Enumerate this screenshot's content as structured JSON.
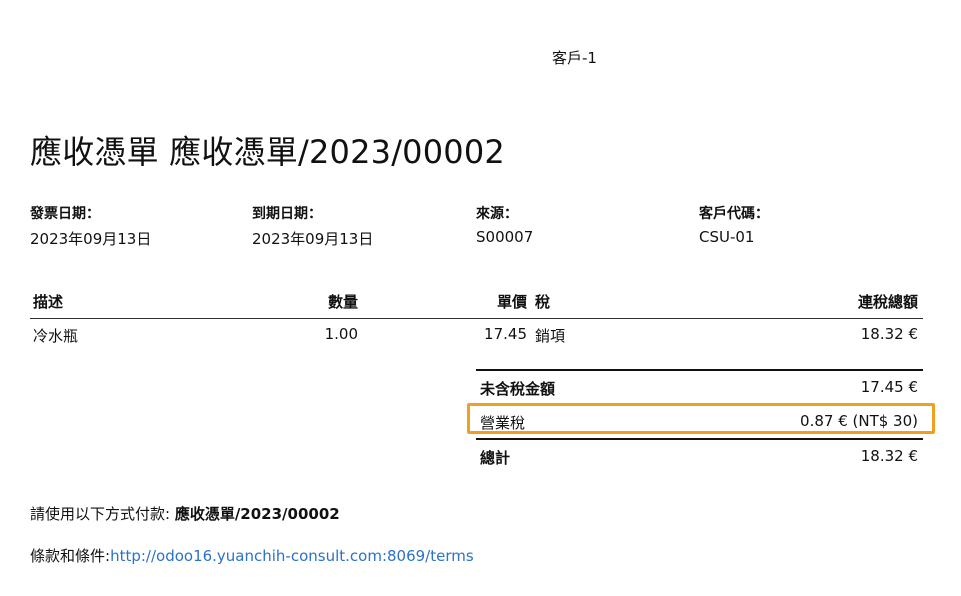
{
  "header": {
    "customer_name": "客戶-1",
    "title": "應收憑單 應收憑單/2023/00002"
  },
  "info": [
    {
      "label": "發票日期：",
      "value": "2023年09月13日"
    },
    {
      "label": "到期日期：",
      "value": "2023年09月13日"
    },
    {
      "label": "來源：",
      "value": "S00007"
    },
    {
      "label": "客戶代碼：",
      "value": "CSU-01"
    }
  ],
  "table": {
    "headers": {
      "description": "描述",
      "quantity": "數量",
      "unit_price": "單價",
      "tax": "稅",
      "total": "連稅總額"
    },
    "rows": [
      {
        "description": "冷水瓶",
        "quantity": "1.00",
        "unit_price": "17.45",
        "tax": "銷項",
        "total": "18.32 €"
      }
    ]
  },
  "totals": {
    "untaxed_label": "未含稅金額",
    "untaxed_value": "17.45 €",
    "tax_label": "營業稅",
    "tax_value": "0.87 € (NT$ 30)",
    "total_label": "總計",
    "total_value": "18.32 €"
  },
  "footer": {
    "payment_prefix": "請使用以下方式付款: ",
    "payment_reference": "應收憑單/2023/00002",
    "terms_prefix": "條款和條件:",
    "terms_link": "http://odoo16.yuanchih-consult.com:8069/terms"
  },
  "colors": {
    "highlight": "#f0a020",
    "link": "#2b72c8"
  }
}
